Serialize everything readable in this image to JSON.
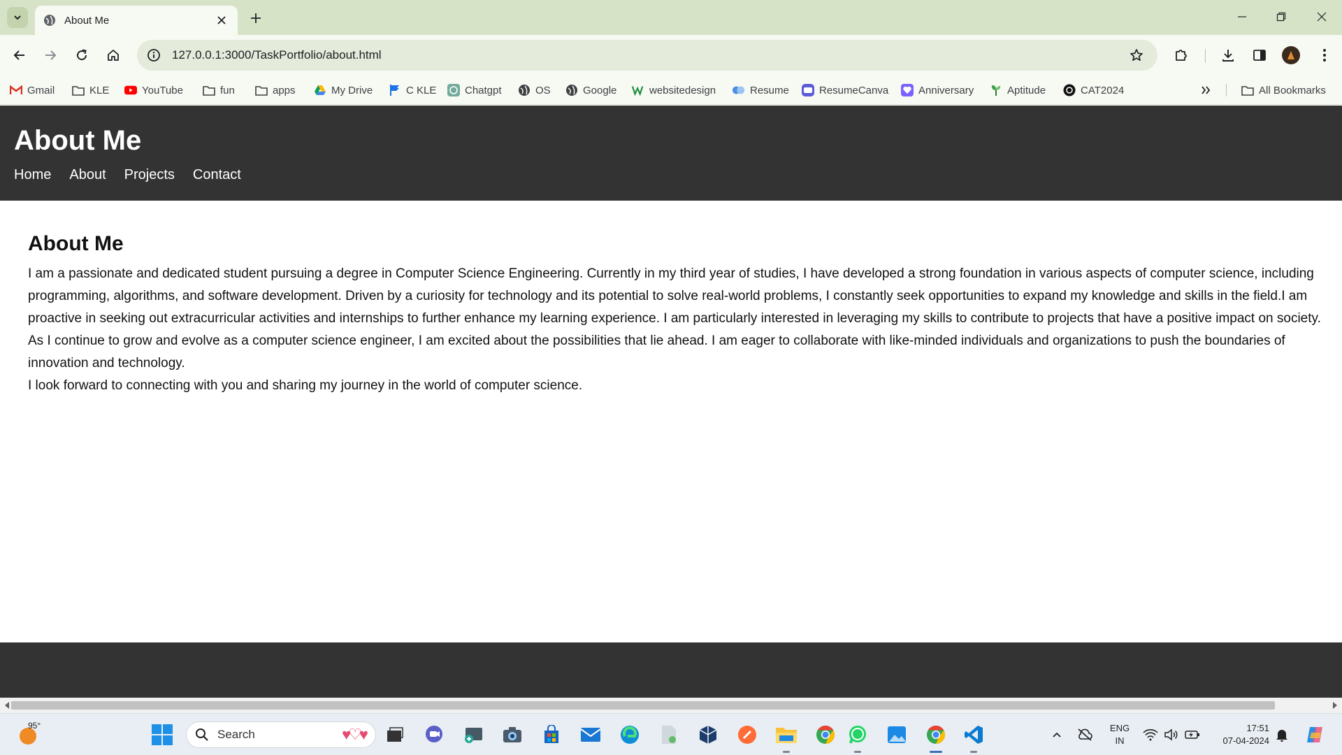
{
  "browser": {
    "tab_title": "About Me",
    "url": "127.0.0.1:3000/TaskPortfolio/about.html",
    "bookmarks": [
      {
        "label": "Gmail",
        "icon": "gmail-icon"
      },
      {
        "label": "KLE",
        "icon": "folder-icon"
      },
      {
        "label": "YouTube",
        "icon": "youtube-icon"
      },
      {
        "label": "fun",
        "icon": "folder-icon"
      },
      {
        "label": "apps",
        "icon": "folder-icon"
      },
      {
        "label": "My Drive",
        "icon": "google-drive-icon"
      },
      {
        "label": "C KLE",
        "icon": "flag-icon"
      },
      {
        "label": "Chatgpt",
        "icon": "chatgpt-icon"
      },
      {
        "label": "OS",
        "icon": "globe-icon"
      },
      {
        "label": "Google",
        "icon": "globe-icon"
      },
      {
        "label": "websitedesign",
        "icon": "w-icon"
      },
      {
        "label": "Resume",
        "icon": "resume-icon"
      },
      {
        "label": "ResumeCanva",
        "icon": "canva-icon"
      },
      {
        "label": "Anniversary",
        "icon": "anniversary-icon"
      },
      {
        "label": "Aptitude",
        "icon": "plant-icon"
      },
      {
        "label": "CAT2024",
        "icon": "cat-icon"
      }
    ],
    "all_bookmarks_label": "All Bookmarks"
  },
  "page": {
    "header_title": "About Me",
    "nav": [
      "Home",
      "About",
      "Projects",
      "Contact"
    ],
    "section_heading": "About Me",
    "paragraph_1": "I am a passionate and dedicated student pursuing a degree in Computer Science Engineering. Currently in my third year of studies, I have developed a strong foundation in various aspects of computer science, including programming, algorithms, and software development. Driven by a curiosity for technology and its potential to solve real-world problems, I constantly seek opportunities to expand my knowledge and skills in the field.I am proactive in seeking out extracurricular activities and internships to further enhance my learning experience. I am particularly interested in leveraging my skills to contribute to projects that have a positive impact on society. As I continue to grow and evolve as a computer science engineer, I am excited about the possibilities that lie ahead. I am eager to collaborate with like-minded individuals and organizations to push the boundaries of innovation and technology.",
    "paragraph_2": "I look forward to connecting with you and sharing my journey in the world of computer science."
  },
  "taskbar": {
    "weather_temp": "95°",
    "search_placeholder": "Search",
    "language_line1": "ENG",
    "language_line2": "IN",
    "time": "17:51",
    "date": "07-04-2024"
  },
  "colors": {
    "header_bg": "#333333",
    "tabbar_bg": "#d7e3c7",
    "toolbar_bg": "#f7f9f3",
    "omnibox_bg": "#e4ebdb",
    "taskbar_bg": "#e8eef3"
  }
}
